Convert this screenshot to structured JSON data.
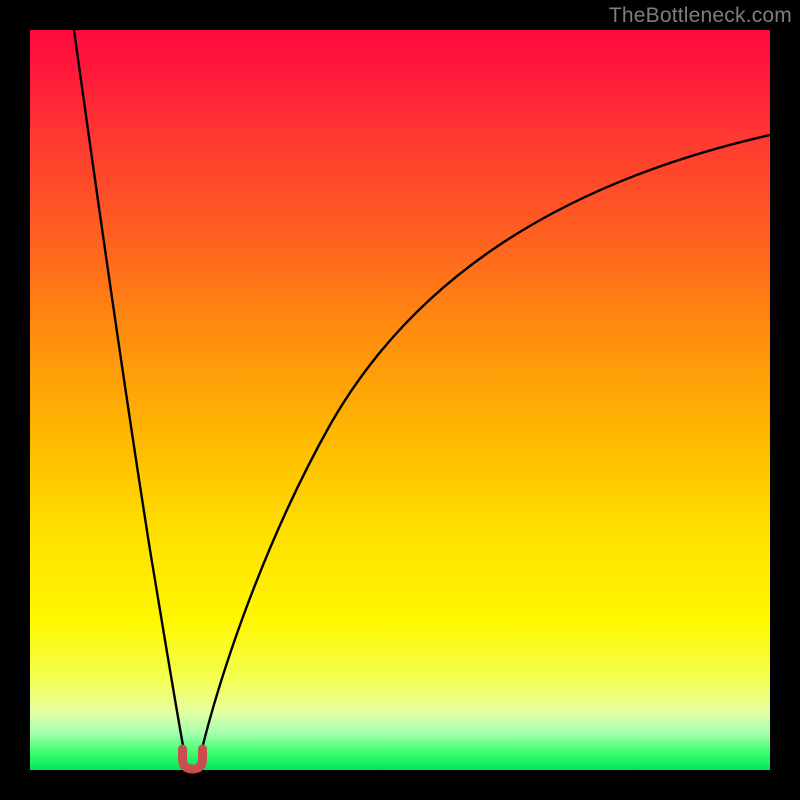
{
  "watermark": "TheBottleneck.com",
  "colors": {
    "background_black": "#000000",
    "curve_stroke": "#000000",
    "marker_fill": "#c94f4f",
    "marker_stroke": "#b23b3b",
    "watermark_text": "#7d7d7d"
  },
  "chart_data": {
    "type": "line",
    "title": "",
    "xlabel": "",
    "ylabel": "",
    "xlim": [
      0,
      100
    ],
    "ylim": [
      0,
      100
    ],
    "grid": false,
    "legend": false,
    "note": "No axis tick labels or numeric annotations are rendered in the image; values below are normalized 0–100 estimates read from pixel positions.",
    "series": [
      {
        "name": "left-branch",
        "x": [
          6,
          8,
          10,
          12,
          14,
          16,
          18,
          19.5,
          20.5
        ],
        "y": [
          100,
          84,
          67,
          51,
          36,
          22,
          10,
          4,
          1
        ]
      },
      {
        "name": "right-branch",
        "x": [
          22.5,
          24,
          27,
          31,
          36,
          43,
          52,
          63,
          76,
          90,
          100
        ],
        "y": [
          1,
          5,
          14,
          26,
          38,
          50,
          60,
          69,
          76,
          82,
          86
        ]
      }
    ],
    "marker": {
      "name": "optimum-u-marker",
      "x_center": 21.3,
      "y_center": 1.6,
      "shape": "u"
    }
  }
}
